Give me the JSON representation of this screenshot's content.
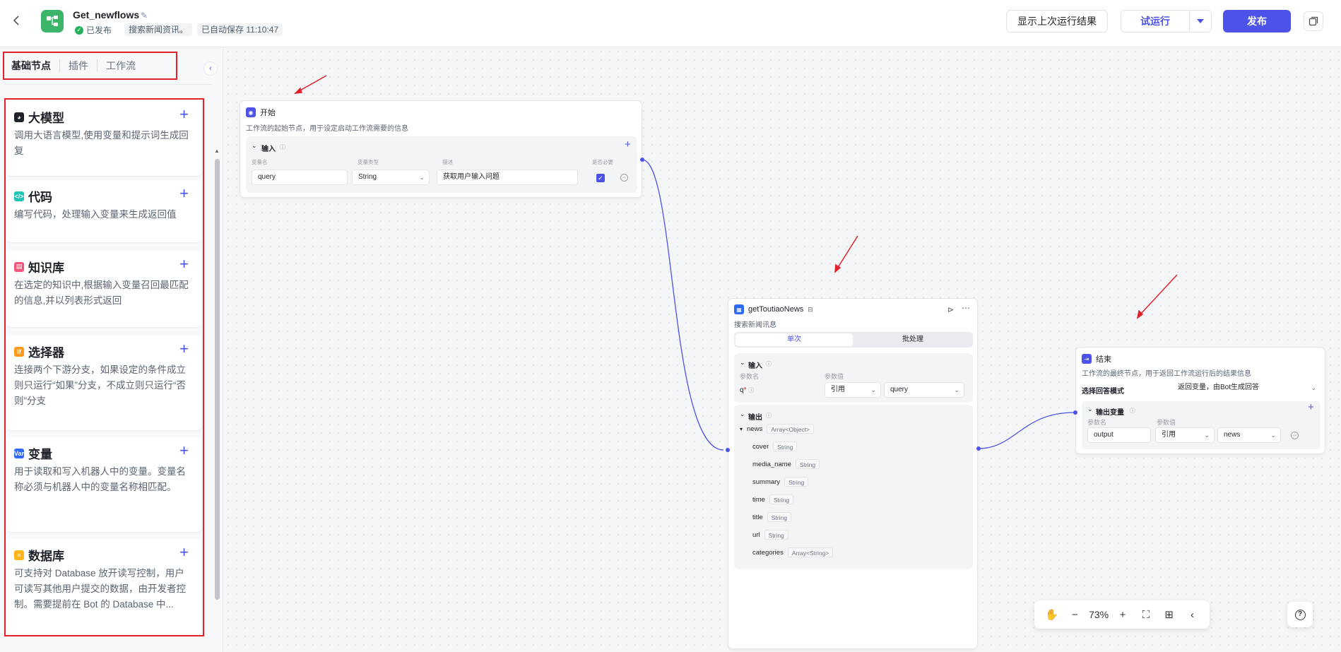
{
  "header": {
    "back_icon": "chevron-left-icon",
    "logo_icon": "workflow-icon",
    "title": "Get_newflows",
    "status": "已发布",
    "description": "搜索新闻资讯。",
    "autosave": "已自动保存 11:10:47",
    "show_last_result": "显示上次运行结果",
    "test_run": "试运行",
    "publish": "发布",
    "accent": "#4d53e8"
  },
  "sidebar": {
    "tabs": [
      "基础节点",
      "插件",
      "工作流"
    ],
    "nodes": [
      {
        "title": "大模型",
        "desc": "调用大语言模型,使用变量和提示词生成回复",
        "icon": "llm-icon",
        "color": "#1f2329"
      },
      {
        "title": "代码",
        "desc": "编写代码，处理输入变量来生成返回值",
        "icon": "code-icon",
        "color": "#20c3b7"
      },
      {
        "title": "知识库",
        "desc": "在选定的知识中,根据输入变量召回最匹配的信息,并以列表形式返回",
        "icon": "knowledge-icon",
        "color": "#f0577a"
      },
      {
        "title": "选择器",
        "desc": "连接两个下游分支，如果设定的条件成立则只运行“如果”分支，不成立则只运行“否则”分支",
        "icon": "if-icon",
        "color": "#ff9a1f"
      },
      {
        "title": "变量",
        "desc": "用于读取和写入机器人中的变量。变量名称必须与机器人中的变量名称相匹配。",
        "icon": "var-icon",
        "color": "#2f6af6"
      },
      {
        "title": "数据库",
        "desc": "可支持对 Database 放开读写控制，用户可读写其他用户提交的数据，由开发者控制。需要提前在 Bot 的 Database 中...",
        "icon": "database-icon",
        "color": "#ffb31a"
      }
    ]
  },
  "start_node": {
    "title": "开始",
    "desc": "工作流的起始节点，用于设定启动工作流需要的信息",
    "input_label": "输入",
    "col_headers": [
      "变量名",
      "变量类型",
      "描述",
      "是否必要"
    ],
    "var_name": "query",
    "var_type": "String",
    "var_desc": "获取用户输入问题"
  },
  "plugin_node": {
    "title": "getToutiaoNews",
    "desc": "搜索新闻讯息",
    "mode_single": "单次",
    "mode_batch": "批处理",
    "input_label": "输入",
    "param_name_label": "参数名",
    "param_value_label": "参数值",
    "param_name": "q",
    "required_mark": "*",
    "param_source": "引用",
    "param_value": "query",
    "output_label": "输出",
    "outputs": [
      {
        "name": "news",
        "type": "Array<Object>"
      },
      {
        "name": "cover",
        "type": "String"
      },
      {
        "name": "media_name",
        "type": "String"
      },
      {
        "name": "summary",
        "type": "String"
      },
      {
        "name": "time",
        "type": "String"
      },
      {
        "name": "title",
        "type": "String"
      },
      {
        "name": "url",
        "type": "String"
      },
      {
        "name": "categories",
        "type": "Array<String>"
      }
    ]
  },
  "end_node": {
    "title": "结束",
    "desc": "工作流的最终节点，用于返回工作流运行后的结果信息",
    "answer_mode_label": "选择回答模式",
    "answer_mode_value": "返回变量，由Bot生成回答",
    "output_var_label": "输出变量",
    "param_name_label": "参数名",
    "param_value_label": "参数值",
    "var_name": "output",
    "source": "引用",
    "value": "news"
  },
  "toolbar": {
    "zoom": "73%",
    "icons": [
      "hand-icon",
      "zoom-out-icon",
      "zoom-in-icon",
      "fit-view-icon",
      "layout-icon",
      "minimap-icon",
      "help-icon"
    ]
  }
}
